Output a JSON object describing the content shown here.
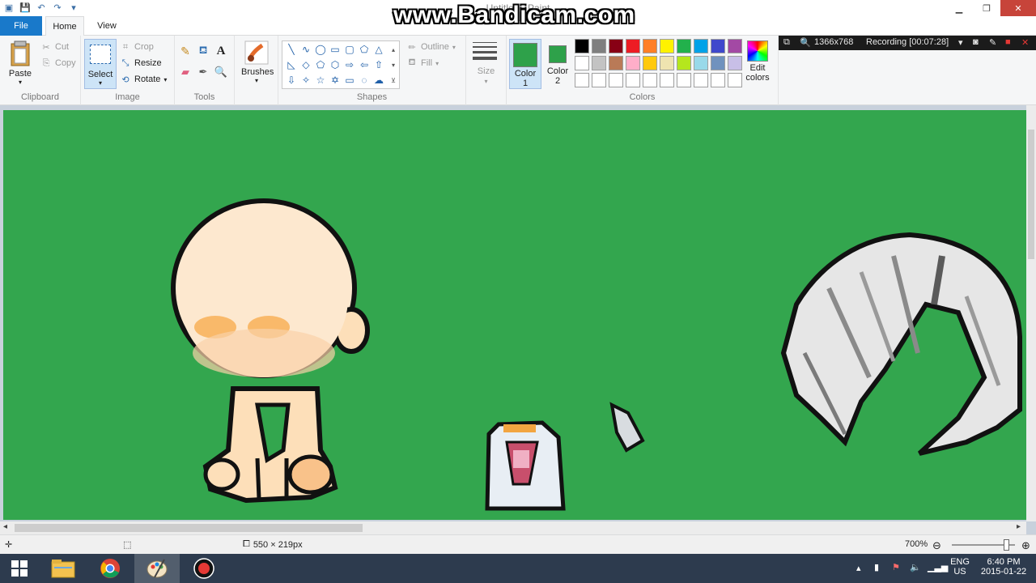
{
  "window": {
    "title": "Untitled - Paint"
  },
  "watermark": "www.Bandicam.com",
  "tabs": {
    "file": "File",
    "home": "Home",
    "view": "View"
  },
  "clipboard": {
    "paste": "Paste",
    "cut": "Cut",
    "copy": "Copy",
    "label": "Clipboard"
  },
  "image": {
    "select": "Select",
    "crop": "Crop",
    "resize": "Resize",
    "rotate": "Rotate",
    "label": "Image"
  },
  "tools": {
    "label": "Tools"
  },
  "brushes": {
    "label": "Brushes"
  },
  "shapes": {
    "outline": "Outline",
    "fill": "Fill",
    "label": "Shapes"
  },
  "size": {
    "label": "Size"
  },
  "colors": {
    "color1_label": "Color",
    "color1_num": "1",
    "color2_label": "Color",
    "color2_num": "2",
    "edit_label": "Edit",
    "edit_label2": "colors",
    "label": "Colors",
    "color1": "#2ea14a",
    "color2": "#2ea14a",
    "palette_row1": [
      "#000000",
      "#7f7f7f",
      "#880015",
      "#ed1c24",
      "#ff7f27",
      "#fff200",
      "#22b14c",
      "#00a2e8",
      "#3f48cc",
      "#a349a4"
    ],
    "palette_row2": [
      "#ffffff",
      "#c3c3c3",
      "#b97a57",
      "#ffaec9",
      "#ffc90e",
      "#efe4b0",
      "#b5e61d",
      "#99d9ea",
      "#7092be",
      "#c8bfe7"
    ]
  },
  "recorder": {
    "resolution": "1366x768",
    "status": "Recording [00:07:28]"
  },
  "canvas": {
    "background": "#33a64e"
  },
  "status": {
    "dimensions": "550 × 219px",
    "zoom": "700%"
  },
  "tray": {
    "lang": "ENG",
    "region": "US",
    "time": "6:40 PM",
    "date": "2015-01-22"
  }
}
